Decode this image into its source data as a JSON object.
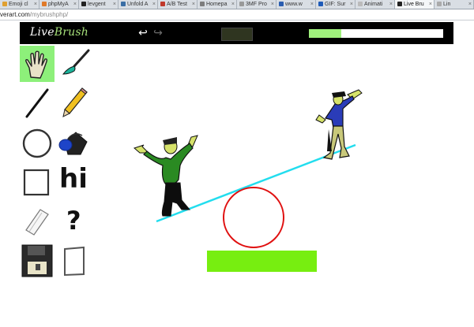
{
  "browser": {
    "tabs": [
      {
        "label": "Emoji cl",
        "active": false,
        "favicon_color": "#e0a030"
      },
      {
        "label": "phpMyA",
        "active": false,
        "favicon_color": "#e07a2a"
      },
      {
        "label": "levgent",
        "active": false,
        "favicon_color": "#222222"
      },
      {
        "label": "Unfold A",
        "active": false,
        "favicon_color": "#3a6ea5"
      },
      {
        "label": "A/B Test",
        "active": false,
        "favicon_color": "#c0392b"
      },
      {
        "label": "Homepa",
        "active": false,
        "favicon_color": "#7d7d7d"
      },
      {
        "label": "3MF Pro",
        "active": false,
        "favicon_color": "#999999"
      },
      {
        "label": "www.w",
        "active": false,
        "favicon_color": "#2a5db0"
      },
      {
        "label": "GIF: Sur",
        "active": false,
        "favicon_color": "#1e5bb8"
      },
      {
        "label": "Animati",
        "active": false,
        "favicon_color": "#bbbbbb"
      },
      {
        "label": "Live Bru",
        "active": true,
        "favicon_color": "#222222"
      },
      {
        "label": "Lin",
        "active": false,
        "favicon_color": "#aaaaaa"
      }
    ],
    "url_host": "verart.com",
    "url_path": "/mybrushphp/"
  },
  "app": {
    "logo_part1": "Live",
    "logo_part2": "Brush",
    "undo_icon": "↩",
    "redo_icon": "↪",
    "current_color": "#2f3520",
    "progress_fraction": 0.24,
    "progress_color": "#9ff07c",
    "selected_tool": "hand",
    "text_tool_label": "hi",
    "help_tool_label": "?"
  },
  "canvas": {
    "shape_colors": {
      "seesaw_line": "#22ddee",
      "circle_outline": "#e01010",
      "rectangle_fill": "#77ee10",
      "left_figure_shirt": "#2a8a22",
      "right_figure_shirt": "#2a3cb8"
    }
  }
}
